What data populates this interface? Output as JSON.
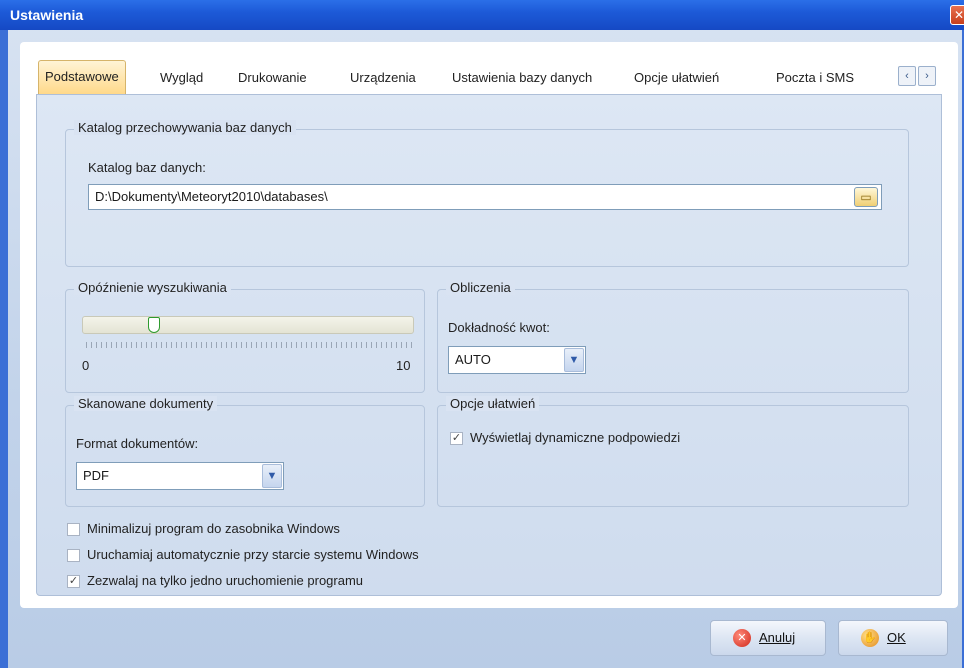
{
  "window": {
    "title": "Ustawienia",
    "close_icon": "close-icon"
  },
  "tabs": [
    {
      "label": "Podstawowe",
      "active": true
    },
    {
      "label": "Wygląd"
    },
    {
      "label": "Drukowanie"
    },
    {
      "label": "Urządzenia"
    },
    {
      "label": "Ustawienia bazy danych"
    },
    {
      "label": "Opcje ułatwień"
    },
    {
      "label": "Poczta i SMS"
    }
  ],
  "db_group": {
    "title": "Katalog przechowywania baz danych",
    "field_label": "Katalog baz danych:",
    "path": "D:\\Dokumenty\\Meteoryt2010\\databases\\"
  },
  "search_delay": {
    "title": "Opóźnienie wyszukiwania",
    "min": "0",
    "max": "10",
    "value": 2
  },
  "calculations": {
    "title": "Obliczenia",
    "label": "Dokładność kwot:",
    "selected": "AUTO"
  },
  "scanned_docs": {
    "title": "Skanowane dokumenty",
    "label": "Format dokumentów:",
    "selected": "PDF"
  },
  "accessibility": {
    "title": "Opcje ułatwień",
    "hints_label": "Wyświetlaj dynamiczne podpowiedzi",
    "hints_checked": true
  },
  "options": [
    {
      "label": "Minimalizuj program do zasobnika Windows",
      "checked": false
    },
    {
      "label": "Uruchamiaj automatycznie przy starcie systemu Windows",
      "checked": false
    },
    {
      "label": "Zezwalaj na tylko jedno uruchomienie programu",
      "checked": true
    }
  ],
  "footer": {
    "cancel_label": "Anuluj",
    "ok_label": "OK"
  },
  "colors": {
    "titlebar": "#1d5ad8",
    "active_tab": "#ffd98a",
    "panel": "#dde7f4"
  }
}
